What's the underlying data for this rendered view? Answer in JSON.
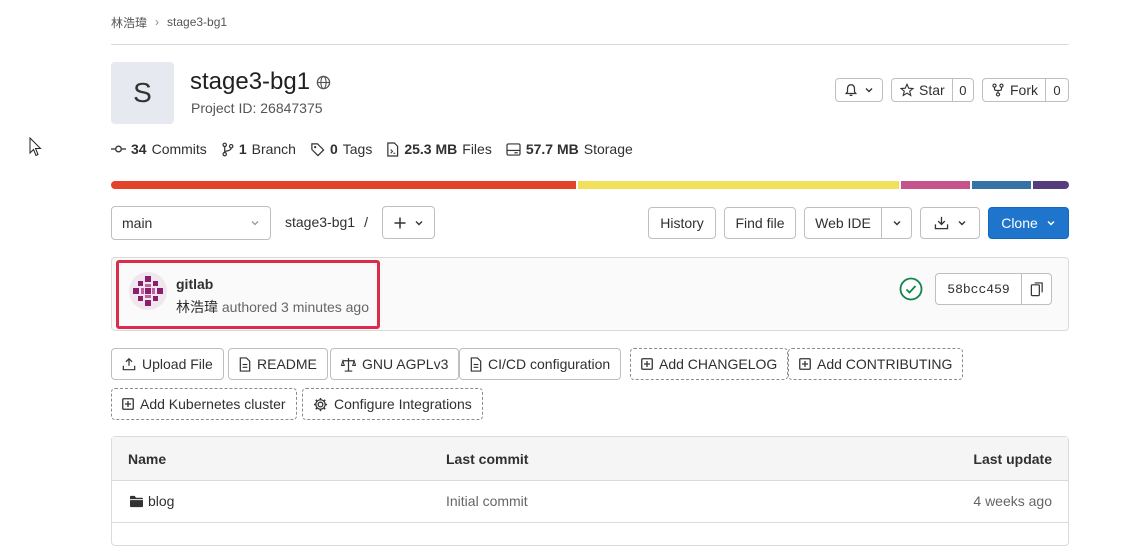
{
  "breadcrumb": {
    "owner": "林浩瑋",
    "separator": "›",
    "project": "stage3-bg1"
  },
  "project": {
    "avatar_letter": "S",
    "name": "stage3-bg1",
    "id_label": "Project ID: 26847375"
  },
  "header_buttons": {
    "star_label": "Star",
    "star_count": "0",
    "fork_label": "Fork",
    "fork_count": "0"
  },
  "stats": {
    "commits": {
      "value": "34",
      "label": "Commits"
    },
    "branches": {
      "value": "1",
      "label": "Branch"
    },
    "tags": {
      "value": "0",
      "label": "Tags"
    },
    "files": {
      "value": "25.3 MB",
      "label": "Files"
    },
    "storage": {
      "value": "57.7 MB",
      "label": "Storage"
    }
  },
  "language_bar": [
    {
      "color": "#e24329",
      "share": 48.7
    },
    {
      "color": "#f1e05a",
      "share": 33.6
    },
    {
      "color": "#c6538c",
      "share": 7.2
    },
    {
      "color": "#3572a5",
      "share": 6.2
    },
    {
      "color": "#563d7c",
      "share": 3.8
    }
  ],
  "repo_nav": {
    "branch": "main",
    "path": "stage3-bg1",
    "path_sep": "/",
    "history": "History",
    "find_file": "Find file",
    "web_ide": "Web IDE",
    "clone": "Clone"
  },
  "commit": {
    "title": "gitlab",
    "author": "林浩瑋",
    "authored": "authored 3 minutes ago",
    "sha": "58bcc459",
    "status": "passed"
  },
  "actions": {
    "upload": "Upload File",
    "readme": "README",
    "license": "GNU AGPLv3",
    "cicd": "CI/CD configuration",
    "changelog": "Add CHANGELOG",
    "contributing": "Add CONTRIBUTING",
    "kubernetes": "Add Kubernetes cluster",
    "integrations": "Configure Integrations"
  },
  "files_table": {
    "headers": {
      "name": "Name",
      "last_commit": "Last commit",
      "last_update": "Last update"
    },
    "rows": [
      {
        "name": "blog",
        "last_commit": "Initial commit",
        "last_update": "4 weeks ago"
      }
    ]
  },
  "colors": {
    "accent": "#1f75cb",
    "highlight": "#dd2b4b",
    "success": "#108548"
  }
}
